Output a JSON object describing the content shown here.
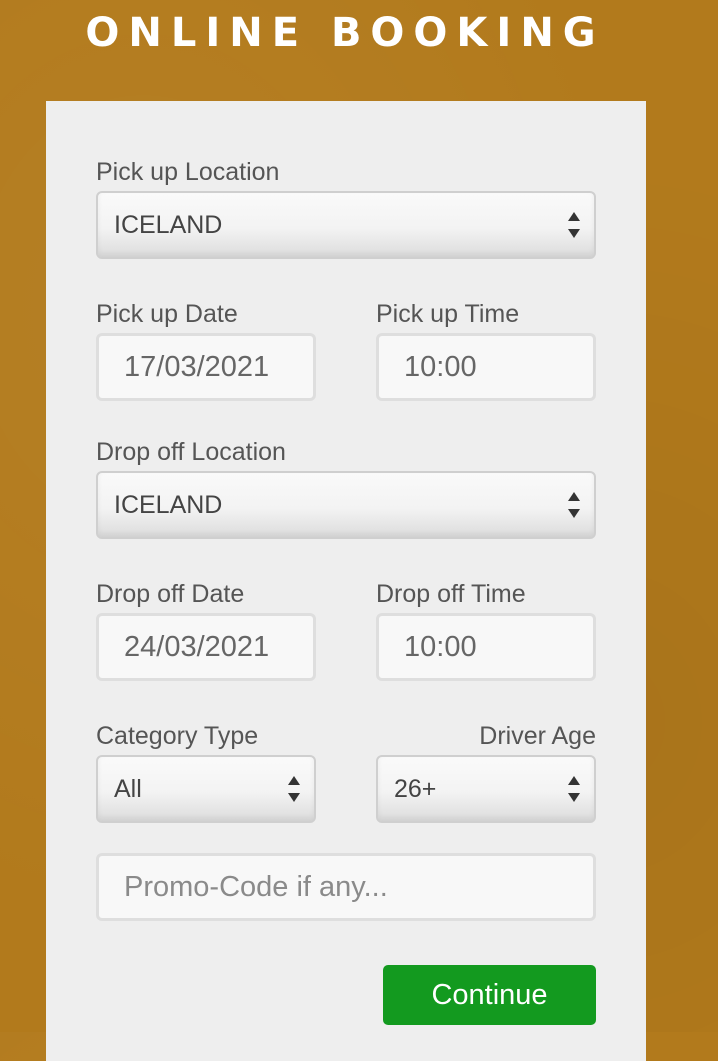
{
  "header": {
    "title": "ONLINE BOOKING"
  },
  "form": {
    "pickup_location": {
      "label": "Pick up Location",
      "value": "ICELAND"
    },
    "pickup_date": {
      "label": "Pick up Date",
      "value": "17/03/2021"
    },
    "pickup_time": {
      "label": "Pick up Time",
      "value": "10:00"
    },
    "dropoff_location": {
      "label": "Drop off Location",
      "value": "ICELAND"
    },
    "dropoff_date": {
      "label": "Drop off Date",
      "value": "24/03/2021"
    },
    "dropoff_time": {
      "label": "Drop off Time",
      "value": "10:00"
    },
    "category_type": {
      "label": "Category Type",
      "value": "All"
    },
    "driver_age": {
      "label": "Driver Age",
      "value": "26+"
    },
    "promo": {
      "placeholder": "Promo-Code if any...",
      "value": ""
    },
    "continue_label": "Continue"
  },
  "colors": {
    "background": "#b27a1c",
    "panel": "#eeeeee",
    "button": "#139a1f"
  },
  "icons": {
    "select_arrows": "up-down-chevron-icon"
  }
}
